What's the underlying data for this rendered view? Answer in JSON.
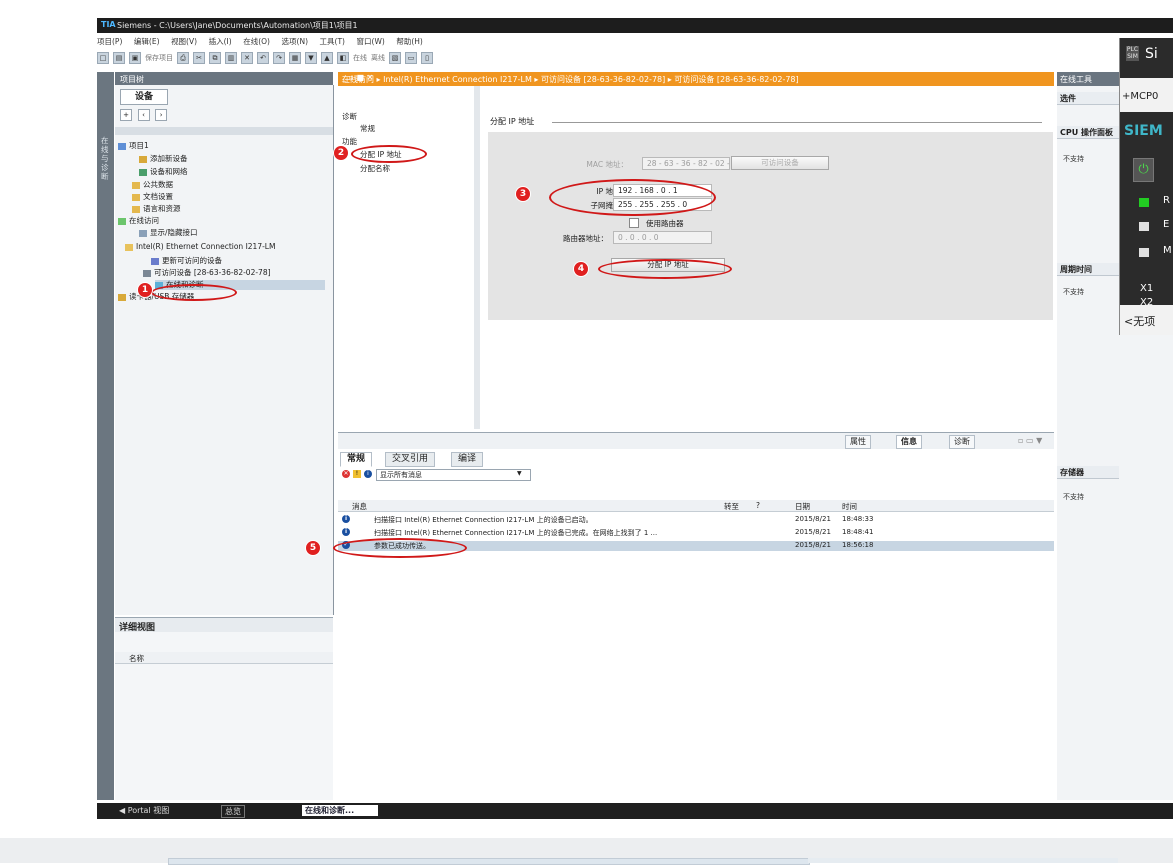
{
  "window": {
    "title": "Siemens  -  C:\\Users\\Jane\\Documents\\Automation\\项目1\\项目1",
    "logo": "TIA"
  },
  "menu": [
    "项目(P)",
    "编辑(E)",
    "视图(V)",
    "插入(I)",
    "在线(O)",
    "选项(N)",
    "工具(T)",
    "窗口(W)",
    "帮助(H)"
  ],
  "toolbar": {
    "save_project": "保存项目",
    "go_online": "在线",
    "go_offline": "离线"
  },
  "side_tab": "在线与诊断",
  "project_tree": {
    "header": "项目树",
    "tab": "设备",
    "items": [
      {
        "label": "项目1",
        "indent": 0
      },
      {
        "label": "添加新设备",
        "indent": 2
      },
      {
        "label": "设备和网络",
        "indent": 2
      },
      {
        "label": "公共数据",
        "indent": 1
      },
      {
        "label": "文档设置",
        "indent": 1
      },
      {
        "label": "语言和资源",
        "indent": 1
      },
      {
        "label": "在线访问",
        "indent": 0
      },
      {
        "label": "显示/隐藏接口",
        "indent": 1
      },
      {
        "label": "Intel(R) Ethernet Connection I217-LM",
        "indent": 1
      },
      {
        "label": "更新可访问的设备",
        "indent": 2
      },
      {
        "label": "可访问设备 [28-63-36-82-02-78]",
        "indent": 2
      },
      {
        "label": "在线和诊断",
        "indent": 3
      },
      {
        "label": "读卡器/USB 存储器",
        "indent": 0
      }
    ]
  },
  "detail_view": {
    "header": "详细视图",
    "col_name": "名称"
  },
  "online_panel": {
    "breadcrumb": "在线访问  ▸  Intel(R) Ethernet Connection I217-LM  ▸  可访问设备 [28-63-36-82-02-78]  ▸  可访问设备 [28-63-36-82-02-78]",
    "nav": {
      "diagnostics": "诊断",
      "general": "常规",
      "functions": "功能",
      "assign_ip": "分配 IP 地址",
      "assign_name": "分配名称"
    }
  },
  "assign_ip": {
    "title": "分配 IP 地址",
    "mac_label": "MAC 地址：",
    "mac_value": "28 - 63 - 36 - 82 - 02 - 78",
    "accessible_btn": "可访问设备",
    "ip_label": "IP 地址：",
    "ip_value": "192 . 168 . 0  . 1",
    "subnet_label": "子网掩码：",
    "subnet_value": "255 . 255 . 255 . 0",
    "use_router": "使用路由器",
    "router_label": "路由器地址：",
    "router_value": "0  .  0  .  0  .  0",
    "assign_btn": "分配 IP 地址"
  },
  "inspector": {
    "tabs": [
      "属性",
      "信息",
      "诊断"
    ]
  },
  "messages": {
    "tabs": [
      "常规",
      "交叉引用",
      "编译"
    ],
    "filter": "显示所有消息",
    "columns": {
      "message": "消息",
      "goto": "转至",
      "q": "?",
      "date": "日期",
      "time": "时间"
    },
    "rows": [
      {
        "text": "扫描接口 Intel(R) Ethernet Connection I217-LM 上的设备已启动。",
        "date": "2015/8/21",
        "time": "18:48:33",
        "icon": "i"
      },
      {
        "text": "扫描接口 Intel(R) Ethernet Connection I217-LM 上的设备已完成。在网络上找到了 1 ...",
        "date": "2015/8/21",
        "time": "18:48:41",
        "icon": "i"
      },
      {
        "text": "参数已成功传送。",
        "date": "2015/8/21",
        "time": "18:56:18",
        "icon": "✓"
      }
    ]
  },
  "online_tools": {
    "header": "在线工具",
    "options": "选件",
    "cpu_panel": "CPU 操作面板",
    "cycle_time": "周期时间",
    "memory": "存储器",
    "not_supported": "不支持"
  },
  "plcsim": {
    "badge_top": "PLC",
    "badge_bottom": "SIM",
    "title": "Si",
    "mcp": "+MCP0",
    "brand": "SIEM",
    "leds": [
      {
        "label": "R",
        "color": "#22cc22"
      },
      {
        "label": "E",
        "color": "#e0e0e0"
      },
      {
        "label": "M",
        "color": "#e0e0e0"
      }
    ],
    "x1": "X1",
    "x2": "X2",
    "bottom": "<无项"
  },
  "taskbar": {
    "portal": "◀ Portal 视图",
    "overview": "总览",
    "online_diag": "在线和诊断..."
  },
  "badges": [
    "1",
    "2",
    "3",
    "4",
    "5"
  ],
  "colors": {
    "accent_orange": "#f0951f",
    "annotation_red": "#d01818"
  }
}
